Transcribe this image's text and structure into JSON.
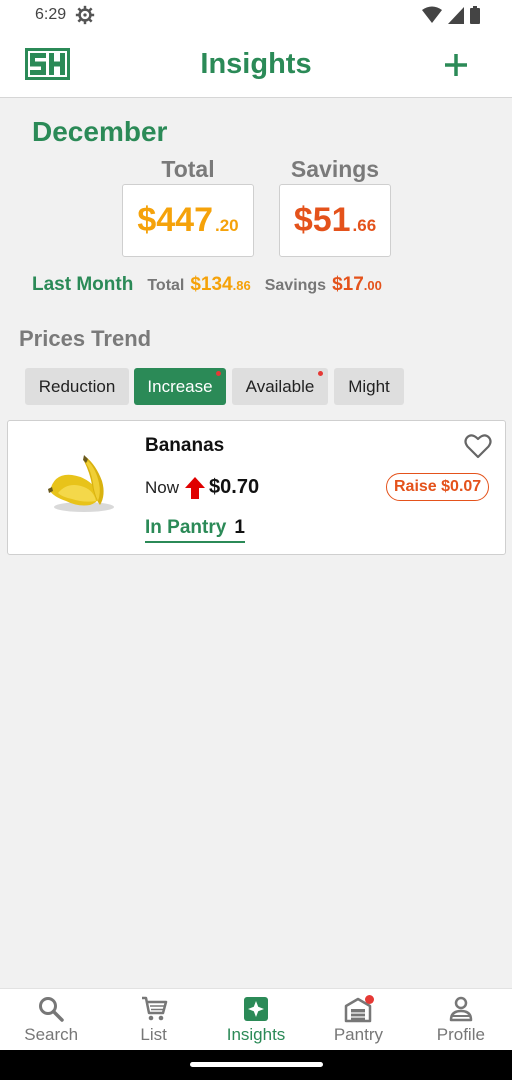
{
  "status": {
    "time": "6:29"
  },
  "app": {
    "title": "Insights"
  },
  "summary": {
    "month": "December",
    "total_label": "Total",
    "savings_label": "Savings",
    "total_dollars": "$447",
    "total_cents": ".20",
    "savings_dollars": "$51",
    "savings_cents": ".66",
    "last_month": {
      "label": "Last Month",
      "total_label": "Total",
      "total_dollars": "$134",
      "total_cents": ".86",
      "savings_label": "Savings",
      "savings_dollars": "$17",
      "savings_cents": ".00"
    }
  },
  "trend": {
    "title": "Prices Trend",
    "chips": [
      {
        "label": "Reduction",
        "active": false,
        "dot": false
      },
      {
        "label": "Increase",
        "active": true,
        "dot": true
      },
      {
        "label": "Available",
        "active": false,
        "dot": true
      },
      {
        "label": "Might",
        "active": false,
        "dot": false
      }
    ]
  },
  "item": {
    "name": "Bananas",
    "now_label": "Now",
    "price": "$0.70",
    "raise": "Raise $0.07",
    "pantry_label": "In Pantry",
    "pantry_count": "1",
    "icons": [
      "banana-image",
      "heart-outline-icon",
      "arrow-up-icon"
    ]
  },
  "nav": {
    "items": [
      {
        "label": "Search",
        "icon": "search-icon"
      },
      {
        "label": "List",
        "icon": "cart-icon"
      },
      {
        "label": "Insights",
        "icon": "insights-icon"
      },
      {
        "label": "Pantry",
        "icon": "pantry-icon"
      },
      {
        "label": "Profile",
        "icon": "person-icon"
      }
    ],
    "active": "Insights"
  },
  "colors": {
    "brand_green": "#2b8a57",
    "total_orange": "#f5a20a",
    "savings_red": "#e4521b",
    "badge_red": "#e53935",
    "background": "#f1f1f1"
  }
}
